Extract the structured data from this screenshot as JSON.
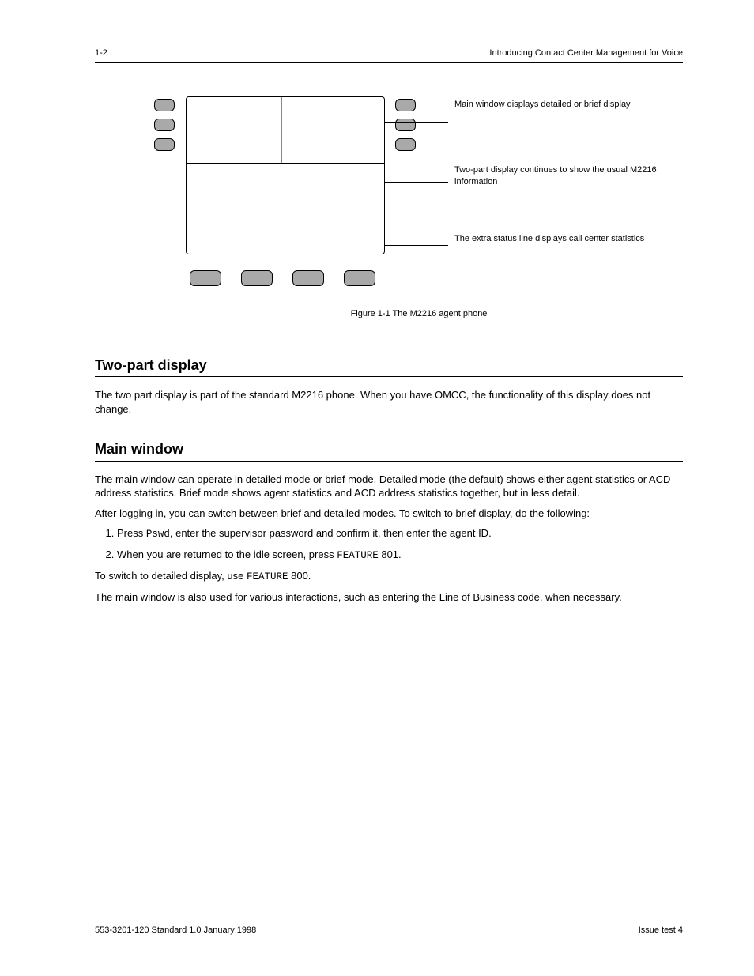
{
  "header": {
    "left": "1-2",
    "right": "Introducing Contact Center Management for Voice"
  },
  "diagram": {
    "caption": "Figure 1-1  The M2216 agent phone",
    "labels": {
      "lbl1": "Main window displays detailed or brief display",
      "lbl2": "Two-part display continues to show the usual M2216 information",
      "lbl3": "The extra status line displays call center statistics"
    }
  },
  "section1": {
    "heading": "Two-part display",
    "p1": "The two part display is part of the standard M2216 phone. When you have OMCC, the functionality of this display does not change."
  },
  "section2": {
    "heading": "Main window",
    "p1": "The main window can operate in detailed mode or brief mode. Detailed mode (the default) shows either agent statistics or ACD address statistics. Brief mode shows agent statistics and ACD address statistics together, but in less detail.",
    "p2": "After logging in, you can switch between brief and detailed modes. To switch to brief display, do the following:",
    "steps": [
      {
        "n": 1,
        "pre": "Press ",
        "mono": "Pswd",
        "post": ", enter the supervisor password and confirm it, then enter the agent ID."
      },
      {
        "n": 2,
        "pre": "When you are returned to the idle screen, press ",
        "mono": "FEATURE",
        "post": " 801."
      }
    ],
    "p3_pre": "To switch to detailed display, use ",
    "p3_mono": "FEATURE",
    "p3_post": " 800.",
    "p4": "The main window is also used for various interactions, such as entering the Line of Business code, when necessary."
  },
  "footer": {
    "left": "553-3201-120 Standard 1.0 January 1998",
    "right": "Issue test 4"
  }
}
